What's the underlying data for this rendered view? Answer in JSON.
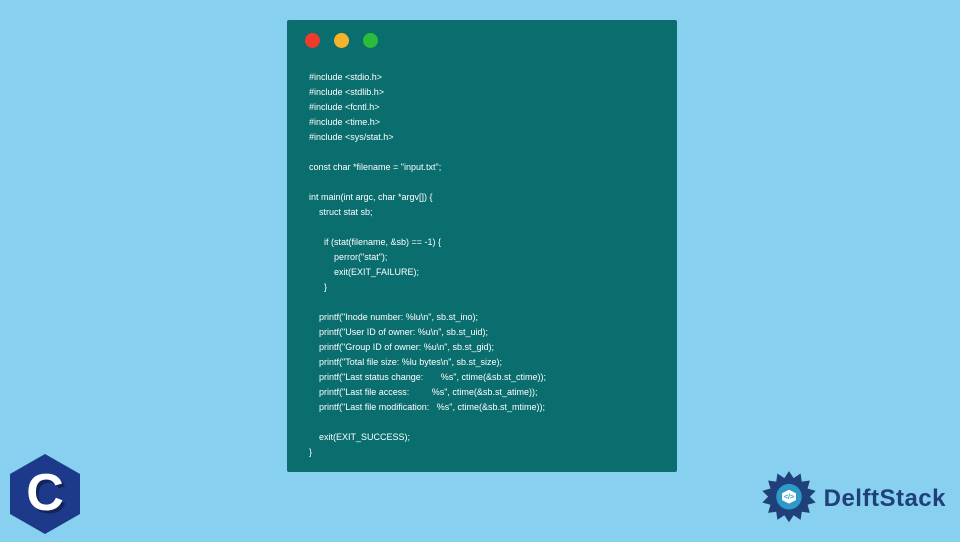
{
  "window": {
    "dots": [
      "red",
      "yellow",
      "green"
    ]
  },
  "code": "#include <stdio.h>\n#include <stdlib.h>\n#include <fcntl.h>\n#include <time.h>\n#include <sys/stat.h>\n\nconst char *filename = \"input.txt\";\n\nint main(int argc, char *argv[]) {\n    struct stat sb;\n\n      if (stat(filename, &sb) == -1) {\n          perror(\"stat\");\n          exit(EXIT_FAILURE);\n      }\n\n    printf(\"Inode number: %lu\\n\", sb.st_ino);\n    printf(\"User ID of owner: %u\\n\", sb.st_uid);\n    printf(\"Group ID of owner: %u\\n\", sb.st_gid);\n    printf(\"Total file size: %lu bytes\\n\", sb.st_size);\n    printf(\"Last status change:       %s\", ctime(&sb.st_ctime));\n    printf(\"Last file access:         %s\", ctime(&sb.st_atime));\n    printf(\"Last file modification:   %s\", ctime(&sb.st_mtime));\n\n    exit(EXIT_SUCCESS);\n}",
  "logos": {
    "c_letter": "C",
    "delft_text": "DelftStack"
  }
}
